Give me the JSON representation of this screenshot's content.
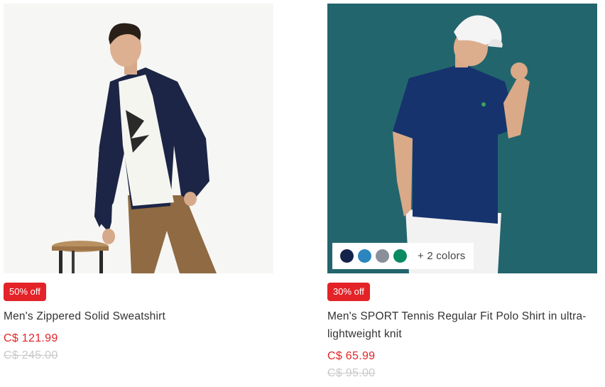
{
  "products": [
    {
      "discount_badge": "50% off",
      "name": "Men's Zippered Solid Sweatshirt",
      "price": "C$ 121.99",
      "original_price": "C$ 245.00"
    },
    {
      "discount_badge": "30% off",
      "name": "Men's SPORT Tennis Regular Fit Polo Shirt in ultra-lightweight knit",
      "price": "C$ 65.99",
      "original_price": "C$ 95.00",
      "color_swatches": [
        {
          "name": "navy",
          "color": "#14234a"
        },
        {
          "name": "blue",
          "color": "#2c86bd"
        },
        {
          "name": "grey-heather",
          "color": "#8a8f99"
        },
        {
          "name": "green",
          "color": "#0a8a63"
        }
      ],
      "more_colors": "+ 2 colors"
    }
  ]
}
